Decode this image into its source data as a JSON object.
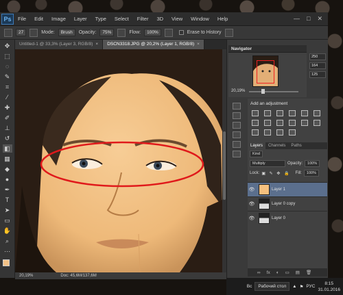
{
  "app": {
    "logo": "Ps",
    "menu": [
      "File",
      "Edit",
      "Image",
      "Layer",
      "Type",
      "Select",
      "Filter",
      "3D",
      "View",
      "Window",
      "Help"
    ],
    "window_controls": [
      "—",
      "□",
      "✕"
    ]
  },
  "options": {
    "brush_size": "27",
    "mode_label": "Mode:",
    "mode_value": "Brush",
    "opacity_label": "Opacity:",
    "opacity_value": "75%",
    "flow_label": "Flow:",
    "flow_value": "100%",
    "erase_history_label": "Erase to History"
  },
  "tabs": [
    {
      "label": "Untitled-1 @ 33,3% (Layer 3, RGB/8)",
      "close": "×"
    },
    {
      "label": "DSCN3318.JPG @ 20,2% (Layer 1, RGB/8)",
      "close": "×"
    }
  ],
  "status": {
    "zoom": "20,19%",
    "doc": "Doc: 45,6M/137,6M"
  },
  "navigator": {
    "title": "Navigator",
    "zoom": "20,19%",
    "zoom_level": 0.28
  },
  "color_values": [
    "250",
    "164",
    "125"
  ],
  "adjustments": {
    "title": "Add an adjustment"
  },
  "layers_panel": {
    "tabs": [
      "Layers",
      "Channels",
      "Paths"
    ],
    "kind_label": "Kind",
    "blend_mode": "Multiply",
    "opacity_label": "Opacity:",
    "opacity_value": "100%",
    "lock_label": "Lock:",
    "fill_label": "Fill:",
    "fill_value": "100%",
    "layers": [
      {
        "name": "Layer 1",
        "selected": true,
        "thumb": "#f5c07e"
      },
      {
        "name": "Layer 0 copy",
        "selected": false,
        "thumb": "#cfcfcf"
      },
      {
        "name": "Layer 0",
        "selected": false,
        "thumb": "#cfcfcf"
      }
    ],
    "footer_icons": [
      "∞",
      "fx",
      "◐",
      "▭",
      "▤",
      "🗑"
    ]
  },
  "taskbar": {
    "desktop_label": "Рабочий стол",
    "lang": "РУС",
    "time": "8:15",
    "date": "31.01.2016",
    "prefix_label": "Вс"
  },
  "colors": {
    "foreground": "#f4c388",
    "background": "#ffffff",
    "sepia": "#f5c489",
    "ellipse": "#e0191b"
  }
}
